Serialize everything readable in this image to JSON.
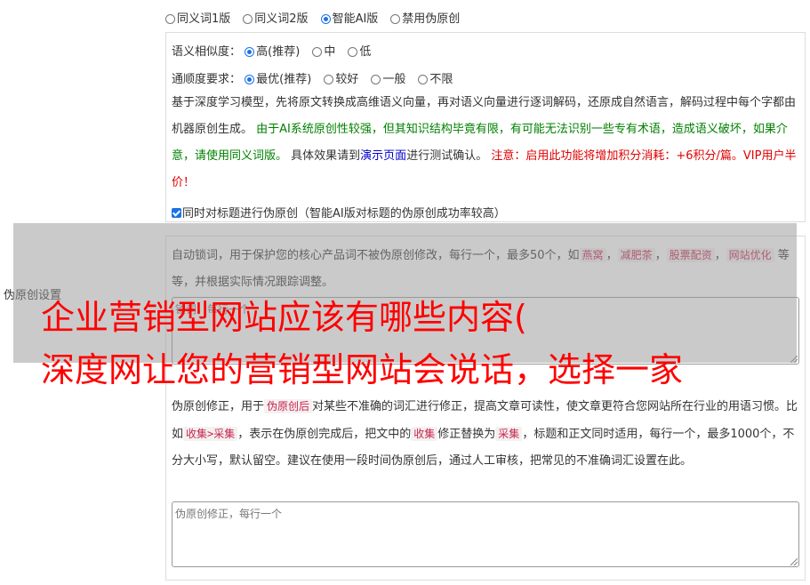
{
  "mode_options": [
    "同义词1版",
    "同义词2版",
    "智能AI版",
    "禁用伪原创"
  ],
  "selected_mode": "智能AI版",
  "similarity": {
    "label": "语义相似度：",
    "options": [
      "高(推荐)",
      "中",
      "低"
    ],
    "selected": "高(推荐)"
  },
  "fluency": {
    "label": "通顺度要求：",
    "options": [
      "最优(推荐)",
      "较好",
      "一般",
      "不限"
    ],
    "selected": "最优(推荐)"
  },
  "description": {
    "part1": "基于深度学习模型，先将原文转换成高维语义向量，再对语义向量进行逐词解码，还原成自然语言，解码过程中每个字都由机器原创生成。",
    "green_text": "由于AI系统原创性较强，但其知识结构毕竟有限，有可能无法识别一些专有术语，造成语义破坏，如果介意，请使用同义词版。",
    "part2": "具体效果请到",
    "link_text": "演示页面",
    "part3": "进行测试确认。",
    "red_text": "注意：启用此功能将增加积分消耗：+6积分/篇。VIP用户半价！"
  },
  "title_checkbox": {
    "label": "同时对标题进行伪原创（智能AI版对标题的伪原创成功率较高）",
    "checked": true
  },
  "side_label": "伪原创设置",
  "lock_words": {
    "intro": "自动锁词，用于保护您的核心产品词不被伪原创修改，每行一个，最多50个，如",
    "examples": [
      "燕窝",
      "减肥茶",
      "股票配资",
      "网站优化"
    ],
    "suffix": "等等，并根据实际情况跟踪调整。",
    "placeholder": "锁词，每行一个"
  },
  "correction": {
    "t1": "伪原创修正，用于",
    "tag1": "伪原创后",
    "t2": "对某些不准确的词汇进行修正，提高文章可读性，使文章更符合您网站所在行业的用语习惯。比如",
    "tag2": "收集>采集",
    "t3": "，表示在伪原创完成后，把文中的",
    "tag3": "收集",
    "t4": "修正替换为",
    "tag4": "采集",
    "t5": "，标题和正文同时适用，每行一个，最多1000个，不分大小写，默认留空。建议在使用一段时间伪原创后，通过人工审核，把常见的不准确词汇设置在此。",
    "placeholder": "伪原创修正，每行一个"
  },
  "headline": {
    "line1": "企业营销型网站应该有哪些内容(",
    "line2": "深度网让您的营销型网站会说话，选择一家"
  },
  "colors": {
    "accent": "#1a73e8",
    "warning": "#e00000",
    "note": "#008000",
    "link": "#0000cc",
    "headline": "#ff0000"
  }
}
